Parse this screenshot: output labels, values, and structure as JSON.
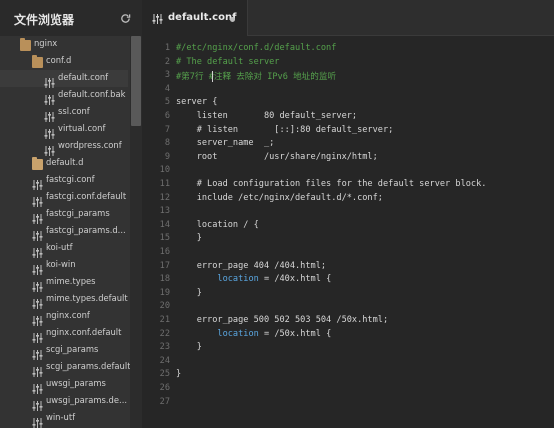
{
  "sidebar": {
    "title": "文件浏览器",
    "items": [
      {
        "label": "nginx",
        "kind": "folder-open",
        "level": 1
      },
      {
        "label": "conf.d",
        "kind": "folder-open",
        "level": 2
      },
      {
        "label": "default.conf",
        "kind": "file",
        "level": 3,
        "active": true
      },
      {
        "label": "default.conf.bak",
        "kind": "file",
        "level": 3
      },
      {
        "label": "ssl.conf",
        "kind": "file",
        "level": 3
      },
      {
        "label": "virtual.conf",
        "kind": "file",
        "level": 3
      },
      {
        "label": "wordpress.conf",
        "kind": "file",
        "level": 3
      },
      {
        "label": "default.d",
        "kind": "folder",
        "level": 2
      },
      {
        "label": "fastcgi.conf",
        "kind": "file",
        "level": 2
      },
      {
        "label": "fastcgi.conf.default",
        "kind": "file",
        "level": 2
      },
      {
        "label": "fastcgi_params",
        "kind": "file",
        "level": 2
      },
      {
        "label": "fastcgi_params.d...",
        "kind": "file",
        "level": 2
      },
      {
        "label": "koi-utf",
        "kind": "file",
        "level": 2
      },
      {
        "label": "koi-win",
        "kind": "file",
        "level": 2
      },
      {
        "label": "mime.types",
        "kind": "file",
        "level": 2
      },
      {
        "label": "mime.types.default",
        "kind": "file",
        "level": 2
      },
      {
        "label": "nginx.conf",
        "kind": "file",
        "level": 2
      },
      {
        "label": "nginx.conf.default",
        "kind": "file",
        "level": 2
      },
      {
        "label": "scgi_params",
        "kind": "file",
        "level": 2
      },
      {
        "label": "scgi_params.default",
        "kind": "file",
        "level": 2
      },
      {
        "label": "uwsgi_params",
        "kind": "file",
        "level": 2
      },
      {
        "label": "uwsgi_params.de...",
        "kind": "file",
        "level": 2
      },
      {
        "label": "win-utf",
        "kind": "file",
        "level": 2
      }
    ]
  },
  "editor": {
    "tab": {
      "title": "default.conf",
      "modified": true
    },
    "lines": [
      {
        "n": "1",
        "text": "#/etc/nginx/conf.d/default.conf",
        "style": "comment"
      },
      {
        "n": "2",
        "text": "# The default server",
        "style": "comment"
      },
      {
        "n": "3",
        "text": "#第7行 #注释 去除对 IPv6 地址的监听",
        "style": "comment",
        "caret": true
      },
      {
        "n": "4",
        "text": "",
        "style": "plain"
      },
      {
        "n": "5",
        "text": "server {",
        "style": "plain"
      },
      {
        "n": "6",
        "text": "    listen       80 default_server;",
        "style": "plain"
      },
      {
        "n": "7",
        "text": "    # listen       [::]:80 default_server;",
        "style": "plain"
      },
      {
        "n": "8",
        "text": "    server_name  _;",
        "style": "plain"
      },
      {
        "n": "9",
        "text": "    root         /usr/share/nginx/html;",
        "style": "plain"
      },
      {
        "n": "10",
        "text": "",
        "style": "plain"
      },
      {
        "n": "11",
        "text": "    # Load configuration files for the default server block.",
        "style": "plain"
      },
      {
        "n": "12",
        "text": "    include /etc/nginx/default.d/*.conf;",
        "style": "plain"
      },
      {
        "n": "13",
        "text": "",
        "style": "plain"
      },
      {
        "n": "14",
        "text": "    location / {",
        "style": "plain"
      },
      {
        "n": "15",
        "text": "    }",
        "style": "plain"
      },
      {
        "n": "16",
        "text": "",
        "style": "plain"
      },
      {
        "n": "17",
        "text": "    error_page 404 /404.html;",
        "style": "plain"
      },
      {
        "n": "18",
        "text": "        location = /40x.html {",
        "style": "location"
      },
      {
        "n": "19",
        "text": "    }",
        "style": "plain"
      },
      {
        "n": "20",
        "text": "",
        "style": "plain"
      },
      {
        "n": "21",
        "text": "    error_page 500 502 503 504 /50x.html;",
        "style": "plain"
      },
      {
        "n": "22",
        "text": "        location = /50x.html {",
        "style": "location"
      },
      {
        "n": "23",
        "text": "    }",
        "style": "plain"
      },
      {
        "n": "24",
        "text": "",
        "style": "plain"
      },
      {
        "n": "25",
        "text": "}",
        "style": "plain"
      },
      {
        "n": "26",
        "text": "",
        "style": "plain"
      },
      {
        "n": "27",
        "text": "",
        "style": "plain"
      }
    ]
  },
  "colors": {
    "comment": "#55a14c",
    "keyword": "#5aa6e0",
    "folder": "#c9a26c"
  },
  "icons": {
    "refresh": "refresh-icon",
    "file": "config-file-icon",
    "folder": "folder-icon"
  }
}
